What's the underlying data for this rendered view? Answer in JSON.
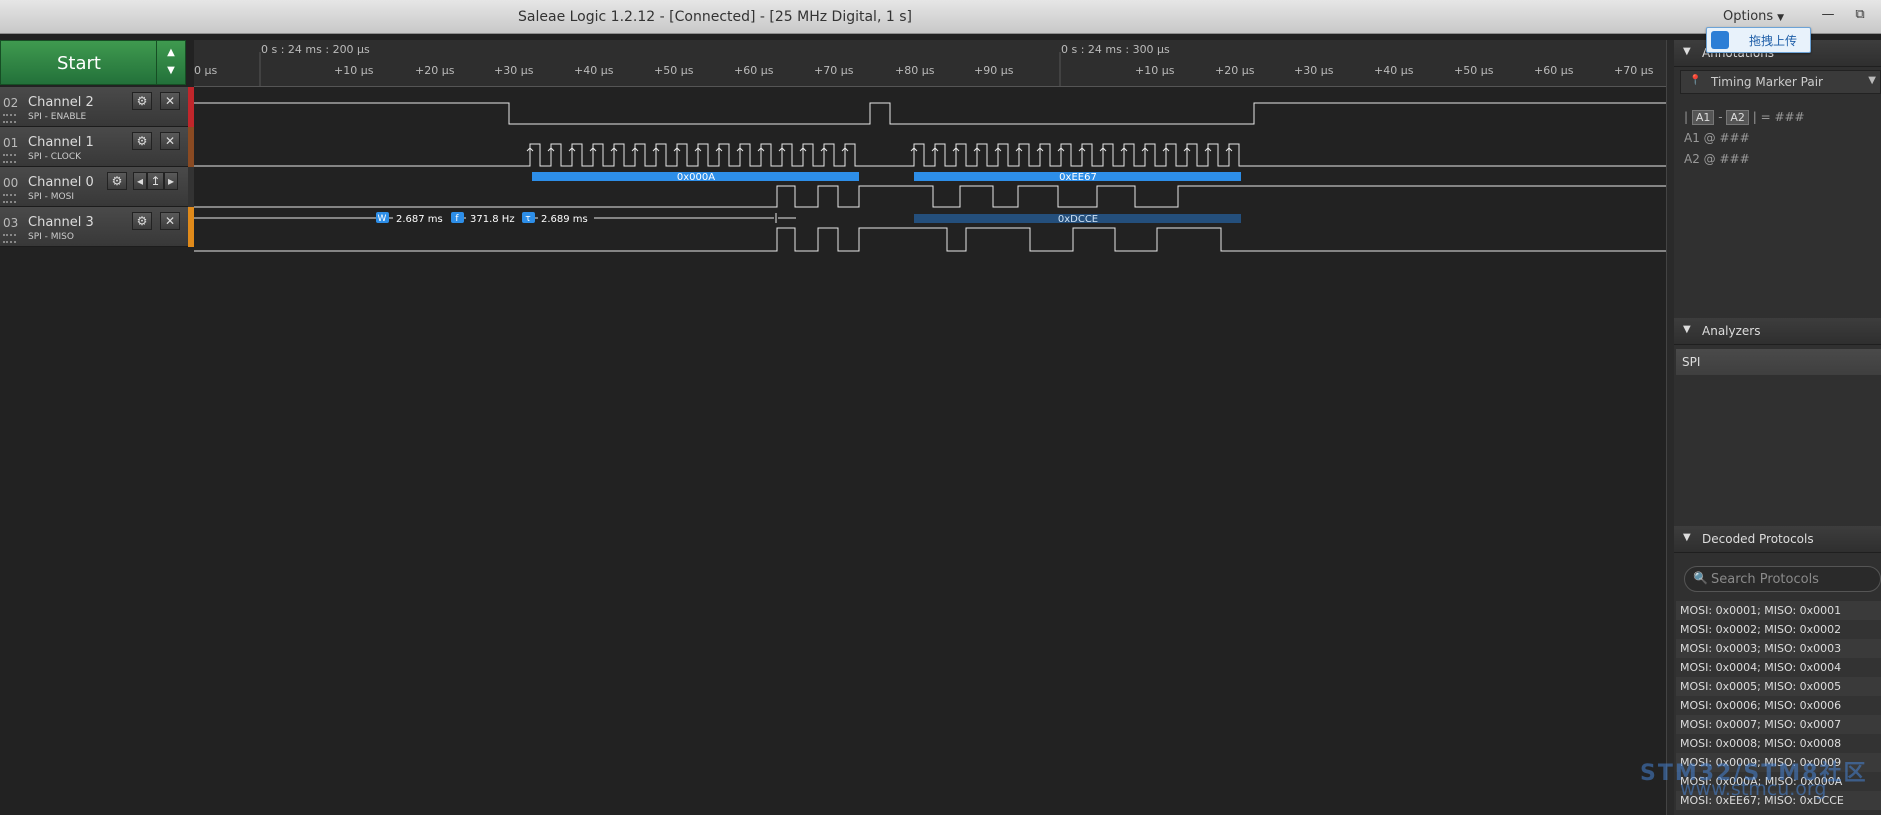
{
  "window": {
    "title": "Saleae Logic 1.2.12 - [Connected] - [25 MHz Digital, 1 s]",
    "options_label": "Options",
    "minimize": "—",
    "restore": "⧉"
  },
  "overlay": {
    "upload_label": "拖拽上传"
  },
  "toolbar": {
    "start_label": "Start"
  },
  "channels": [
    {
      "num": "02",
      "name": "Channel 2",
      "sub": "SPI - ENABLE",
      "color": "#c0262b"
    },
    {
      "num": "01",
      "name": "Channel 1",
      "sub": "SPI - CLOCK",
      "color": "#8a4a22"
    },
    {
      "num": "00",
      "name": "Channel 0",
      "sub": "SPI - MOSI",
      "color": "#333333"
    },
    {
      "num": "03",
      "name": "Channel 3",
      "sub": "SPI - MISO",
      "color": "#e08a1a"
    }
  ],
  "ruler": {
    "marker1": "0 s : 24 ms : 200 µs",
    "marker2": "0 s : 24 ms : 300 µs",
    "ticks": [
      "0 µs",
      "+10 µs",
      "+20 µs",
      "+30 µs",
      "+40 µs",
      "+50 µs",
      "+60 µs",
      "+70 µs",
      "+80 µs",
      "+90 µs",
      "+10 µs",
      "+20 µs",
      "+30 µs",
      "+40 µs",
      "+50 µs",
      "+60 µs",
      "+70 µs"
    ]
  },
  "decode": {
    "mosi_a": "0x000A",
    "mosi_b": "0xEE67",
    "miso_b": "0xDCCE"
  },
  "measure": {
    "width": "2.687 ms",
    "freq": "371.8 Hz",
    "period": "2.689 ms",
    "w_icon": "W",
    "f_icon": "f",
    "t_icon": "τ"
  },
  "panel": {
    "annotations_title": "Annotations",
    "timing_pair": "Timing Marker Pair",
    "a1": "A1",
    "a2": "A2",
    "diff_value": "| = ###",
    "a1_value": "A1  @  ###",
    "a2_value": "A2  @  ###",
    "analyzers_title": "Analyzers",
    "analyzer_item": "SPI",
    "decoded_title": "Decoded Protocols",
    "search_placeholder": "Search Protocols",
    "decoded": [
      "MOSI: 0x0001;  MISO: 0x0001",
      "MOSI: 0x0002;  MISO: 0x0002",
      "MOSI: 0x0003;  MISO: 0x0003",
      "MOSI: 0x0004;  MISO: 0x0004",
      "MOSI: 0x0005;  MISO: 0x0005",
      "MOSI: 0x0006;  MISO: 0x0006",
      "MOSI: 0x0007;  MISO: 0x0007",
      "MOSI: 0x0008;  MISO: 0x0008",
      "MOSI: 0x0009;  MISO: 0x0009",
      "MOSI: 0x000A;  MISO: 0x000A",
      "MOSI: 0xEE67;  MISO: 0xDCCE"
    ]
  },
  "watermark": {
    "line1": "STM32/STM8社区",
    "line2": "www.stmcu.org"
  },
  "colors": {
    "decode_bar": "#2d8ee8",
    "decode_dim": "#244f7c",
    "wave": "#e8e8e8"
  }
}
